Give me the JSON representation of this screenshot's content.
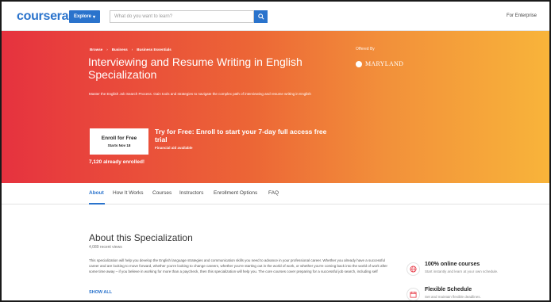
{
  "nav": {
    "logo": "coursera",
    "explore_label": "Explore",
    "search_placeholder": "What do you want to learn?",
    "enterprise_label": "For Enterprise"
  },
  "breadcrumbs": [
    "Browse",
    "Business",
    "Business Essentials"
  ],
  "hero": {
    "title": "Interviewing and Resume Writing in English Specialization",
    "subtitle": "Master the English Job Search Process. Gain tools and strategies to navigate the complex path of interviewing and resume writing in English",
    "offered_by_label": "Offered By",
    "university": "MARYLAND",
    "enroll_label": "Enroll for Free",
    "enroll_sub": "Starts Nov 18",
    "trial_text": "Try for Free: Enroll to start your 7-day full access free trial",
    "financial_aid": "Financial aid available",
    "enrolled_count": "7,120 already enrolled!"
  },
  "tabs": [
    "About",
    "How It Works",
    "Courses",
    "Instructors",
    "Enrollment Options",
    "FAQ"
  ],
  "about": {
    "title": "About this Specialization",
    "recent_views": "4,089 recent views",
    "description": "This specialization will help you develop the English language strategies and communication skills you need to advance in your professional career. Whether you already have a successful career and are looking to move forward, whether you're looking to change careers, whether you're starting out in the world of work, or whether you're coming back into the world of work after some time away – if you believe in working for more than a paycheck, then this specialization will help you. The core courses cover preparing for a successful job search, including self",
    "show_all": "SHOW ALL"
  },
  "features": [
    {
      "icon": "globe-icon",
      "title": "100% online courses",
      "sub": "Start instantly and learn at your own schedule."
    },
    {
      "icon": "calendar-icon",
      "title": "Flexible Schedule",
      "sub": "Set and maintain flexible deadlines."
    }
  ],
  "colors": {
    "brand_blue": "#2a73cc",
    "hero_start": "#e6323f",
    "hero_end": "#f8b43a"
  }
}
